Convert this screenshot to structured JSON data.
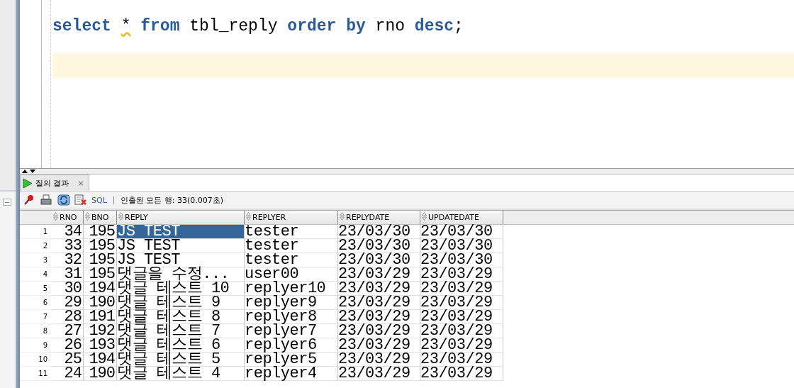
{
  "editor": {
    "tokens": [
      {
        "text": "select",
        "kind": "keyword"
      },
      {
        "text": "*",
        "kind": "warning"
      },
      {
        "text": "from",
        "kind": "keyword"
      },
      {
        "text": "tbl_reply",
        "kind": "plain"
      },
      {
        "text": "order",
        "kind": "keyword"
      },
      {
        "text": "by",
        "kind": "keyword"
      },
      {
        "text": "rno",
        "kind": "plain"
      },
      {
        "text": "desc",
        "kind": "keyword"
      },
      {
        "text": ";",
        "kind": "punct"
      }
    ]
  },
  "results_tab": {
    "label": "질의 결과",
    "close": "×"
  },
  "toolbar": {
    "sql": "SQL",
    "status": "인출된 모든 행: 33(0.007초)"
  },
  "table": {
    "columns": [
      "RNO",
      "BNO",
      "REPLY",
      "REPLYER",
      "REPLYDATE",
      "UPDATEDATE"
    ],
    "rows": [
      {
        "num": "1",
        "cells": [
          "34",
          "195",
          "JS TEST",
          "tester",
          "23/03/30",
          "23/03/30"
        ],
        "selected": true
      },
      {
        "num": "2",
        "cells": [
          "33",
          "195",
          "JS TEST",
          "tester",
          "23/03/30",
          "23/03/30"
        ],
        "selected": false
      },
      {
        "num": "3",
        "cells": [
          "32",
          "195",
          "JS TEST",
          "tester",
          "23/03/30",
          "23/03/30"
        ],
        "selected": false
      },
      {
        "num": "4",
        "cells": [
          "31",
          "195",
          "댓글을 수정...",
          "user00",
          "23/03/29",
          "23/03/29"
        ],
        "selected": false
      },
      {
        "num": "5",
        "cells": [
          "30",
          "194",
          "댓글 테스트 10",
          "replyer10",
          "23/03/29",
          "23/03/29"
        ],
        "selected": false
      },
      {
        "num": "6",
        "cells": [
          "29",
          "190",
          "댓글 테스트 9",
          "replyer9",
          "23/03/29",
          "23/03/29"
        ],
        "selected": false
      },
      {
        "num": "7",
        "cells": [
          "28",
          "191",
          "댓글 테스트 8",
          "replyer8",
          "23/03/29",
          "23/03/29"
        ],
        "selected": false
      },
      {
        "num": "8",
        "cells": [
          "27",
          "192",
          "댓글 테스트 7",
          "replyer7",
          "23/03/29",
          "23/03/29"
        ],
        "selected": false
      },
      {
        "num": "9",
        "cells": [
          "26",
          "193",
          "댓글 테스트 6",
          "replyer6",
          "23/03/29",
          "23/03/29"
        ],
        "selected": false
      },
      {
        "num": "10",
        "cells": [
          "25",
          "194",
          "댓글 테스트 5",
          "replyer5",
          "23/03/29",
          "23/03/29"
        ],
        "selected": false
      },
      {
        "num": "11",
        "cells": [
          "24",
          "190",
          "댓글 테스트 4",
          "replyer4",
          "23/03/29",
          "23/03/29"
        ],
        "selected": false
      }
    ]
  }
}
